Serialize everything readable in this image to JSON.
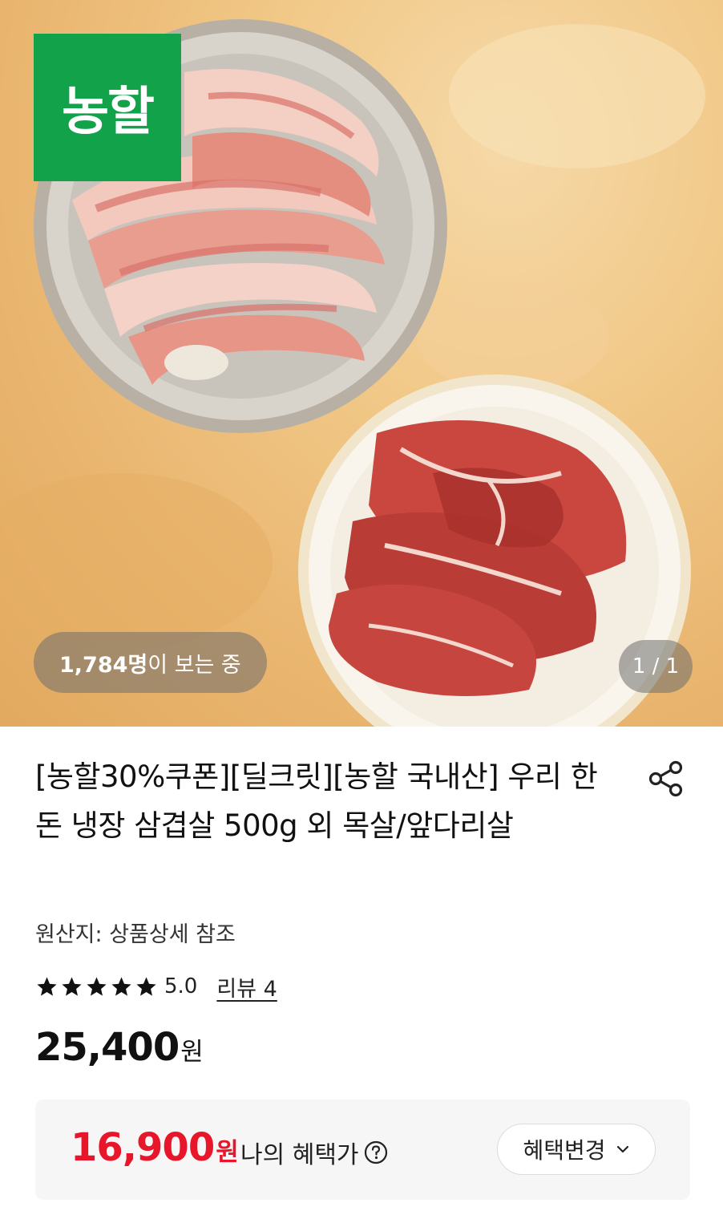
{
  "hero": {
    "brand_badge": "농할",
    "viewers": {
      "count": "1,784명",
      "suffix": "이 보는 중"
    },
    "page_indicator": "1 / 1"
  },
  "product": {
    "title": "[농할30%쿠폰][딜크릿][농할 국내산] 우리 한돈 냉장 삼겹살 500g 외 목살/앞다리살",
    "origin": "원산지: 상품상세 참조",
    "rating": {
      "stars": 5,
      "value": "5.0"
    },
    "review_link": "리뷰 4",
    "price": {
      "amount": "25,400",
      "unit": "원"
    }
  },
  "benefit": {
    "price": {
      "amount": "16,900",
      "unit": "원"
    },
    "label": "나의 혜택가",
    "change_button": "혜택변경"
  },
  "colors": {
    "brand_green": "#12a24a",
    "sale_red": "#e8162a"
  },
  "icons": [
    "share-icon",
    "star-icon",
    "help-circle-icon",
    "chevron-down-icon"
  ]
}
